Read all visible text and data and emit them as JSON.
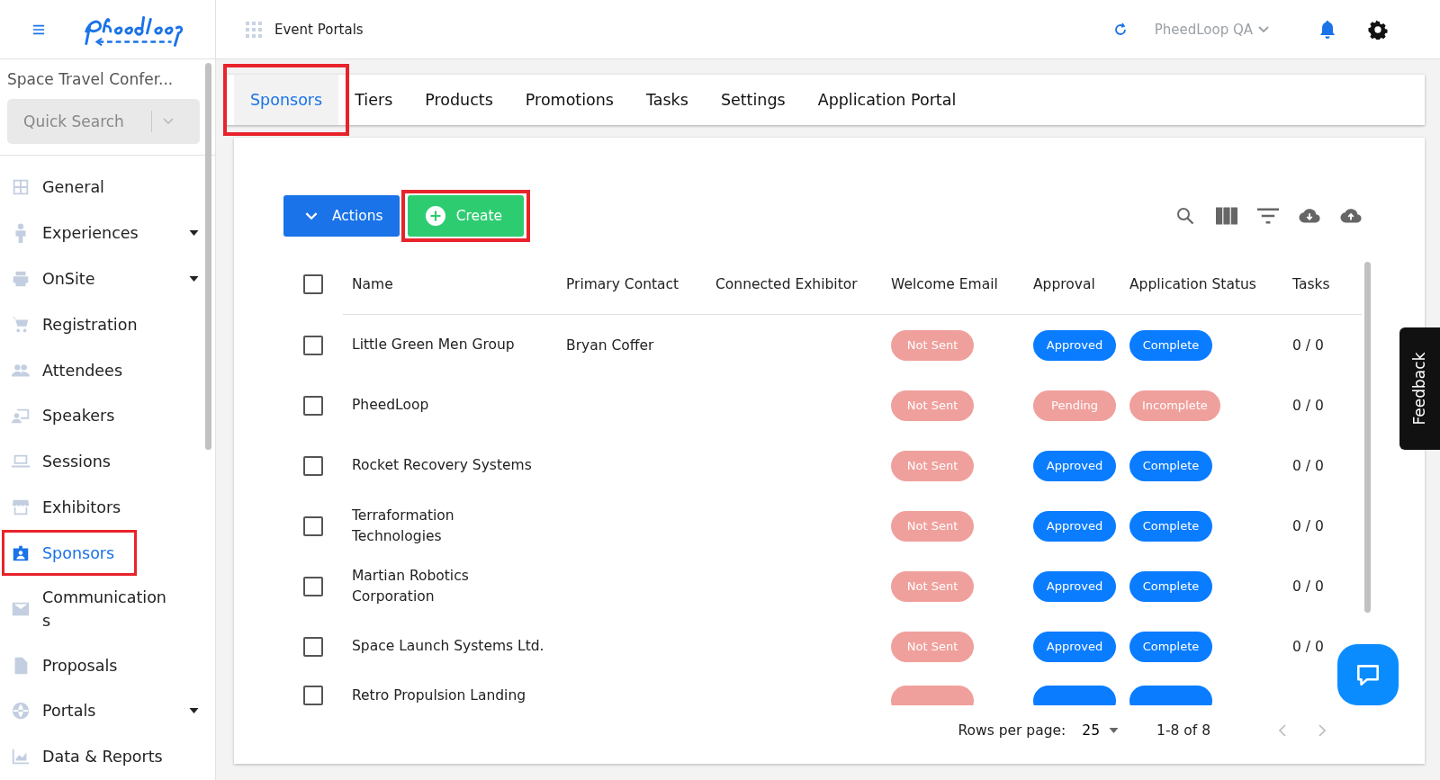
{
  "header": {
    "title": "Event Portals",
    "account": "PheedLoop QA"
  },
  "sidebar": {
    "event": "Space Travel Confer...",
    "search": {
      "placeholder": "Quick Search"
    },
    "items": [
      {
        "label": "General",
        "selected": false,
        "expandable": false,
        "highlight": false
      },
      {
        "label": "Experiences",
        "selected": false,
        "expandable": true,
        "highlight": false
      },
      {
        "label": "OnSite",
        "selected": false,
        "expandable": true,
        "highlight": false
      },
      {
        "label": "Registration",
        "selected": false,
        "expandable": false,
        "highlight": false
      },
      {
        "label": "Attendees",
        "selected": false,
        "expandable": false,
        "highlight": false
      },
      {
        "label": "Speakers",
        "selected": false,
        "expandable": false,
        "highlight": false
      },
      {
        "label": "Sessions",
        "selected": false,
        "expandable": false,
        "highlight": false
      },
      {
        "label": "Exhibitors",
        "selected": false,
        "expandable": false,
        "highlight": false
      },
      {
        "label": "Sponsors",
        "selected": true,
        "expandable": false,
        "highlight": true
      },
      {
        "label": "Communications",
        "selected": false,
        "expandable": false,
        "highlight": false
      },
      {
        "label": "Proposals",
        "selected": false,
        "expandable": false,
        "highlight": false
      },
      {
        "label": "Portals",
        "selected": false,
        "expandable": true,
        "highlight": false
      },
      {
        "label": "Data & Reports",
        "selected": false,
        "expandable": false,
        "highlight": false
      }
    ]
  },
  "tabs": [
    {
      "label": "Sponsors",
      "selected": true,
      "highlight": true
    },
    {
      "label": "Tiers",
      "selected": false,
      "highlight": false
    },
    {
      "label": "Products",
      "selected": false,
      "highlight": false
    },
    {
      "label": "Promotions",
      "selected": false,
      "highlight": false
    },
    {
      "label": "Tasks",
      "selected": false,
      "highlight": false
    },
    {
      "label": "Settings",
      "selected": false,
      "highlight": false
    },
    {
      "label": "Application Portal",
      "selected": false,
      "highlight": false
    }
  ],
  "actions": {
    "label": "Actions"
  },
  "create": {
    "label": "Create",
    "highlight": true
  },
  "table": {
    "all_checked": false,
    "columns": [
      "Name",
      "Primary Contact",
      "Connected Exhibitor",
      "Welcome Email",
      "Approval",
      "Application Status",
      "Tasks"
    ],
    "rows": [
      {
        "checked": false,
        "name": "Little Green Men Group",
        "contact": "Bryan Coffer",
        "email": {
          "text": "Not Sent",
          "kind": "muted"
        },
        "approval": {
          "text": "Approved",
          "kind": "primary"
        },
        "status": {
          "text": "Complete",
          "kind": "primary"
        },
        "tasks": "0 / 0"
      },
      {
        "checked": false,
        "name": "PheedLoop",
        "email": {
          "text": "Not Sent",
          "kind": "muted"
        },
        "approval": {
          "text": "Pending",
          "kind": "muted"
        },
        "status": {
          "text": "Incomplete",
          "kind": "muted"
        },
        "tasks": "0 / 0"
      },
      {
        "checked": false,
        "name": "Rocket Recovery Systems",
        "email": {
          "text": "Not Sent",
          "kind": "muted"
        },
        "approval": {
          "text": "Approved",
          "kind": "primary"
        },
        "status": {
          "text": "Complete",
          "kind": "primary"
        },
        "tasks": "0 / 0"
      },
      {
        "checked": false,
        "name": "Terraformation Technologies",
        "email": {
          "text": "Not Sent",
          "kind": "muted"
        },
        "approval": {
          "text": "Approved",
          "kind": "primary"
        },
        "status": {
          "text": "Complete",
          "kind": "primary"
        },
        "tasks": "0 / 0"
      },
      {
        "checked": false,
        "name": "Martian Robotics Corporation",
        "email": {
          "text": "Not Sent",
          "kind": "muted"
        },
        "approval": {
          "text": "Approved",
          "kind": "primary"
        },
        "status": {
          "text": "Complete",
          "kind": "primary"
        },
        "tasks": "0 / 0"
      },
      {
        "checked": false,
        "name": "Space Launch Systems Ltd.",
        "email": {
          "text": "Not Sent",
          "kind": "muted"
        },
        "approval": {
          "text": "Approved",
          "kind": "primary"
        },
        "status": {
          "text": "Complete",
          "kind": "primary"
        },
        "tasks": "0 / 0"
      },
      {
        "checked": false,
        "name": "Retro Propulsion Landing",
        "email": {
          "kind": "muted"
        },
        "approval": {
          "kind": "primary"
        },
        "status": {
          "kind": "primary"
        }
      }
    ]
  },
  "pagination": {
    "label": "Rows per page:",
    "per_page": "25",
    "range": "1-8 of 8"
  },
  "feedback": "Feedback"
}
